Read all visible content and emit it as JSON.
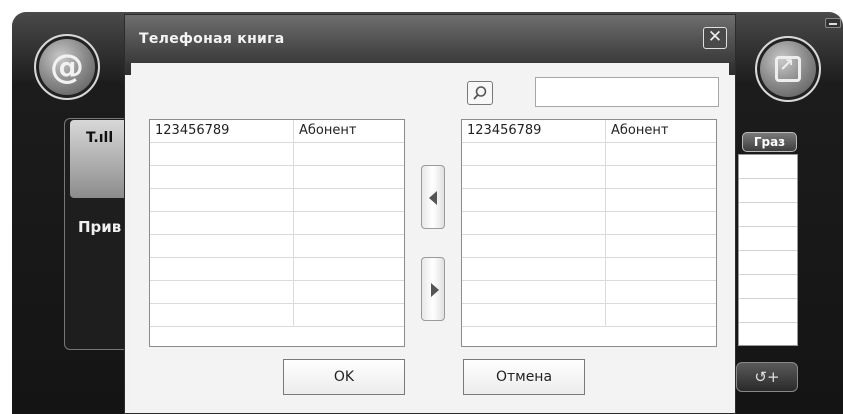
{
  "background_app": {
    "at_button_icon": "at-sign-icon",
    "export_button_icon": "export-icon",
    "signal_icon": "signal-strength-icon",
    "signal_text": "T.ıll",
    "side_label": "Прив",
    "right_tab_label": "Граз",
    "call_button_glyph": "↺+"
  },
  "dialog": {
    "title": "Телефоная книга",
    "close_glyph": "✕",
    "search": {
      "value": "",
      "placeholder": ""
    },
    "left_table": {
      "rows": [
        {
          "number": "123456789",
          "name": "Абонент"
        },
        {
          "number": "",
          "name": ""
        },
        {
          "number": "",
          "name": ""
        },
        {
          "number": "",
          "name": ""
        },
        {
          "number": "",
          "name": ""
        },
        {
          "number": "",
          "name": ""
        },
        {
          "number": "",
          "name": ""
        },
        {
          "number": "",
          "name": ""
        },
        {
          "number": "",
          "name": ""
        }
      ]
    },
    "right_table": {
      "rows": [
        {
          "number": "123456789",
          "name": "Абонент"
        },
        {
          "number": "",
          "name": ""
        },
        {
          "number": "",
          "name": ""
        },
        {
          "number": "",
          "name": ""
        },
        {
          "number": "",
          "name": ""
        },
        {
          "number": "",
          "name": ""
        },
        {
          "number": "",
          "name": ""
        },
        {
          "number": "",
          "name": ""
        },
        {
          "number": "",
          "name": ""
        }
      ]
    },
    "ok_label": "OK",
    "cancel_label": "Отмена"
  }
}
